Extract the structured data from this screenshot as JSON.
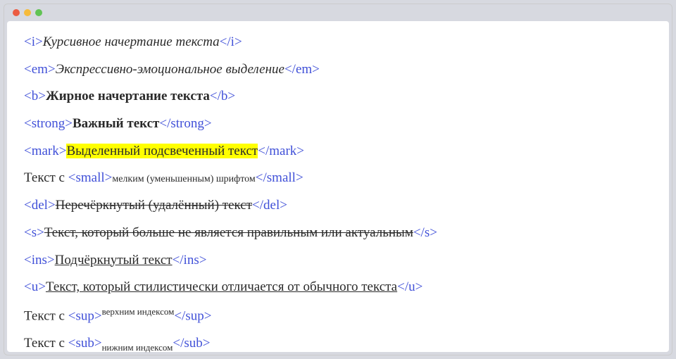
{
  "lines": {
    "i": {
      "open": "<i>",
      "close": "</i>",
      "text": "Курсивное начертание текста"
    },
    "em": {
      "open": "<em>",
      "close": "</em>",
      "text": "Экспрессивно-эмоциональное выделение"
    },
    "b": {
      "open": "<b>",
      "close": "</b>",
      "text": "Жирное начертание текста"
    },
    "strong": {
      "open": "<strong>",
      "close": "</strong>",
      "text": "Важный текст"
    },
    "mark": {
      "open": "<mark>",
      "close": "</mark>",
      "text": "Выделенный подсвеченный текст"
    },
    "small": {
      "prefix": "Текст с ",
      "open": "<small>",
      "close": "</small>",
      "text": "мелким (уменьшенным) шрифтом"
    },
    "del": {
      "open": "<del>",
      "close": "</del>",
      "text": "Перечёркнутый (удалённый) текст"
    },
    "s": {
      "open": "<s>",
      "close": "</s>",
      "text": "Текст, который больше не является правильным или актуальным"
    },
    "ins": {
      "open": "<ins>",
      "close": "</ins>",
      "text": "Подчёркнутый текст"
    },
    "u": {
      "open": "<u>",
      "close": "</u>",
      "text": "Текст, который стилистически отличается от обычного текста"
    },
    "sup": {
      "prefix": "Текст с ",
      "open": "<sup>",
      "close": "</sup>",
      "text": "верхним индексом"
    },
    "sub": {
      "prefix": "Текст с ",
      "open": "<sub>",
      "close": "</sub>",
      "text": "нижним индексом"
    }
  }
}
